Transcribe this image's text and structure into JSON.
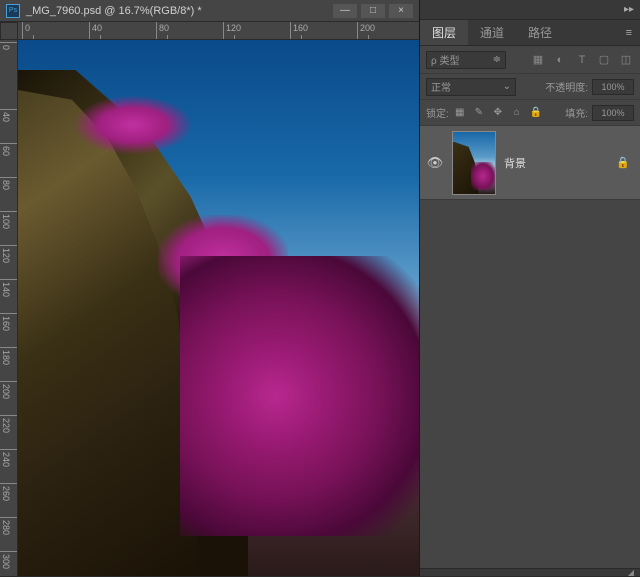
{
  "titlebar": {
    "filename": "_MG_7960.psd @ 16.7%(RGB/8*) *",
    "minimize": "—",
    "maximize": "□",
    "close": "×"
  },
  "ruler": {
    "h": [
      "0",
      "40",
      "80",
      "120",
      "160",
      "200"
    ],
    "v": [
      "0",
      "40",
      "60",
      "80",
      "100",
      "120",
      "140",
      "160",
      "180",
      "200",
      "220",
      "240",
      "260",
      "280",
      "300"
    ]
  },
  "panels": {
    "tabs": {
      "layers": "图层",
      "channels": "通道",
      "paths": "路径"
    },
    "filter": {
      "kind": "ρ 类型",
      "icons": [
        "▦",
        "◐",
        "T",
        "▢",
        "◫"
      ]
    },
    "blend": {
      "mode": "正常",
      "opacity_label": "不透明度:",
      "opacity_value": "100%"
    },
    "lock": {
      "label": "锁定:",
      "icons": [
        "▦",
        "✎",
        "✥",
        "⌂",
        "🔒"
      ],
      "fill_label": "填充:",
      "fill_value": "100%"
    },
    "layers": [
      {
        "name": "背景",
        "locked": true
      }
    ]
  }
}
